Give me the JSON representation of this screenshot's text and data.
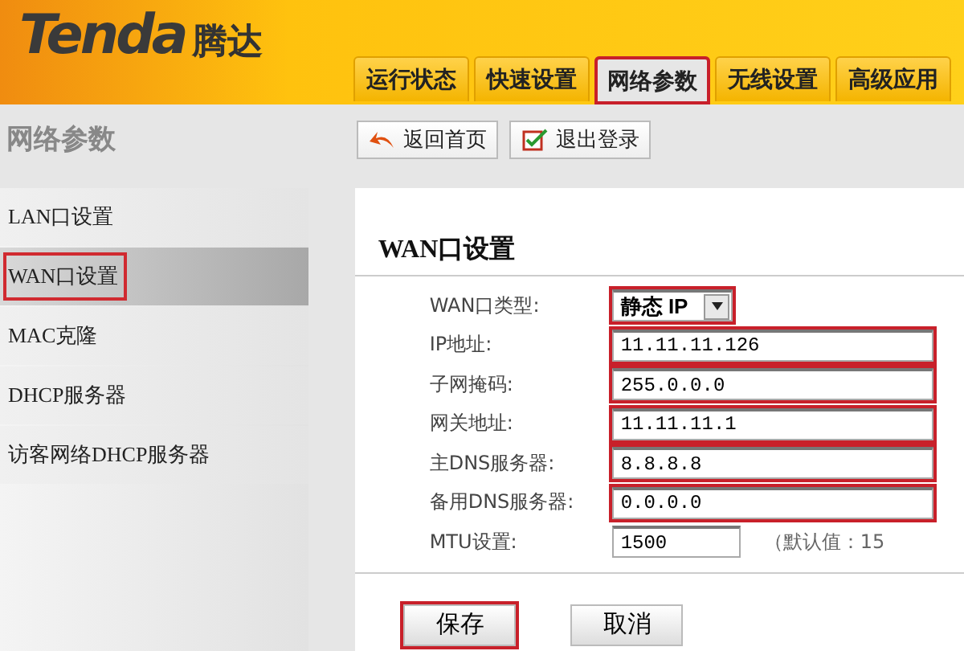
{
  "header": {
    "logo": "Tenda",
    "logo_cn": "腾达"
  },
  "tabs": [
    {
      "label": "运行状态",
      "selected": false,
      "highlighted": false
    },
    {
      "label": "快速设置",
      "selected": false,
      "highlighted": false
    },
    {
      "label": "网络参数",
      "selected": true,
      "highlighted": true
    },
    {
      "label": "无线设置",
      "selected": false,
      "highlighted": false
    },
    {
      "label": "高级应用",
      "selected": false,
      "highlighted": false
    }
  ],
  "section_title": "网络参数",
  "toolbar": [
    {
      "kind": "home",
      "label": "返回首页"
    },
    {
      "kind": "logout",
      "label": "退出登录"
    }
  ],
  "sidebar": {
    "items": [
      {
        "label": "LAN口设置",
        "selected": false,
        "highlighted": false
      },
      {
        "label": "WAN口设置",
        "selected": true,
        "highlighted": true
      },
      {
        "label": "MAC克隆",
        "selected": false,
        "highlighted": false
      },
      {
        "label": "DHCP服务器",
        "selected": false,
        "highlighted": false
      },
      {
        "label": "访客网络DHCP服务器",
        "selected": false,
        "highlighted": false
      }
    ]
  },
  "form": {
    "title": "WAN口设置",
    "rows": [
      {
        "kind": "select",
        "label": "WAN口类型:",
        "value": "静态 IP",
        "highlighted": true
      },
      {
        "kind": "input",
        "label": "IP地址:",
        "value": "11.11.11.126",
        "highlighted": true
      },
      {
        "kind": "input",
        "label": "子网掩码:",
        "value": "255.0.0.0",
        "highlighted": true
      },
      {
        "kind": "input",
        "label": "网关地址:",
        "value": "11.11.11.1",
        "highlighted": true
      },
      {
        "kind": "input",
        "label": "主DNS服务器:",
        "value": "8.8.8.8",
        "highlighted": true
      },
      {
        "kind": "input",
        "label": "备用DNS服务器:",
        "value": "0.0.0.0",
        "highlighted": true
      },
      {
        "kind": "short-input",
        "label": "MTU设置:",
        "value": "1500",
        "hint": "（默认值：15",
        "highlighted": false
      }
    ],
    "buttons": [
      {
        "label": "保存",
        "highlighted": true
      },
      {
        "label": "取消",
        "highlighted": false
      }
    ]
  }
}
